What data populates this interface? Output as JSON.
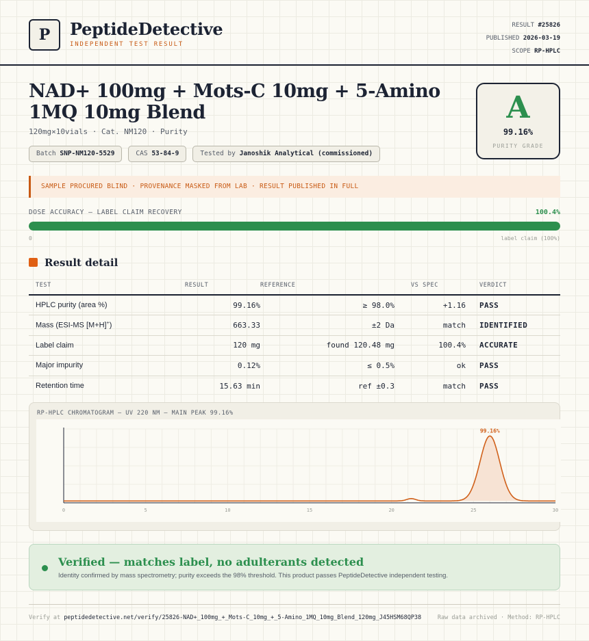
{
  "brand": {
    "logo_letter": "P",
    "name": "PeptideDetective",
    "subtitle": "INDEPENDENT TEST RESULT"
  },
  "meta": {
    "result_label": "RESULT",
    "result_value": "#25826",
    "published_label": "PUBLISHED",
    "published_value": "2026-03-19",
    "scope_label": "SCOPE",
    "scope_value": "RP-HPLC"
  },
  "product": {
    "title": "NAD+ 100mg + Mots-C 10mg + 5-Amino 1MQ 10mg Blend",
    "subline": "120mg×10vials · Cat. NM120 · Purity",
    "chips": {
      "batch_label": "Batch",
      "batch_value": "SNP-NM120-5529",
      "cas_label": "CAS",
      "cas_value": "53-84-9",
      "tested_label": "Tested by",
      "tested_value": "Janoshik Analytical (commissioned)"
    }
  },
  "grade": {
    "letter": "A",
    "value": "99.16%",
    "label": "PURITY GRADE"
  },
  "banner": {
    "text": "SAMPLE PROCURED BLIND · PROVENANCE MASKED FROM LAB · RESULT PUBLISHED IN FULL"
  },
  "dose": {
    "label": "DOSE ACCURACY — LABEL CLAIM RECOVERY",
    "value_text": "100.4%",
    "fill_fraction": 1.0,
    "min_label": "0",
    "max_label": "label claim (100%)"
  },
  "results": {
    "section_title": "Result detail",
    "headers": {
      "test": "TEST",
      "result": "RESULT",
      "reference": "REFERENCE",
      "vs_spec": "VS SPEC",
      "verdict": "VERDICT"
    },
    "rows": [
      {
        "test": "HPLC purity (area %)",
        "result": "99.16%",
        "reference": "≥ 98.0%",
        "vs_spec": "+1.16",
        "verdict": "PASS"
      },
      {
        "test": "Mass (ESI-MS [M+H]",
        "test_sup": "+",
        "test_end": ")",
        "result": "663.33",
        "reference": "±2 Da",
        "vs_spec": "match",
        "verdict": "IDENTIFIED"
      },
      {
        "test": "Label claim",
        "result": "120 mg",
        "reference": "found 120.48 mg",
        "vs_spec": "100.4%",
        "verdict": "ACCURATE"
      },
      {
        "test": "Major impurity",
        "result": "0.12%",
        "reference": "≤ 0.5%",
        "vs_spec": "ok",
        "verdict": "PASS"
      },
      {
        "test": "Retention time",
        "result": "15.63 min",
        "reference": "ref ±0.3",
        "vs_spec": "match",
        "verdict": "PASS"
      }
    ]
  },
  "chart_data": {
    "type": "line",
    "title": "RP-HPLC CHROMATOGRAM — UV 220 NM — MAIN PEAK 99.16%",
    "x_ticks": [
      "0",
      "5",
      "10",
      "15",
      "20",
      "25",
      "30"
    ],
    "xlim": [
      0,
      30
    ],
    "ylim": [
      0,
      100
    ],
    "peak_label": "99.16%",
    "peaks": [
      {
        "center": 21.2,
        "height": 3.2,
        "width": 0.28
      },
      {
        "center": 26.0,
        "height": 88,
        "width": 0.6
      }
    ],
    "baseline": 2.5,
    "line_color": "#d0601a",
    "fill_color": "#f7e3d4",
    "grid": true
  },
  "verified": {
    "title": "Verified — matches label, no adulterants detected",
    "description": "Identity confirmed by mass spectrometry; purity exceeds the 98% threshold. This product passes PeptideDetective independent testing."
  },
  "footer": {
    "verify_label": "Verify at",
    "verify_url": "peptidedetective.net/verify/25826-NAD+_100mg_+_Mots-C_10mg_+_5-Amino_1MQ_10mg_Blend_120mg_J45HSM68QP38",
    "right_text": "Raw data archived · Method: RP-HPLC"
  }
}
